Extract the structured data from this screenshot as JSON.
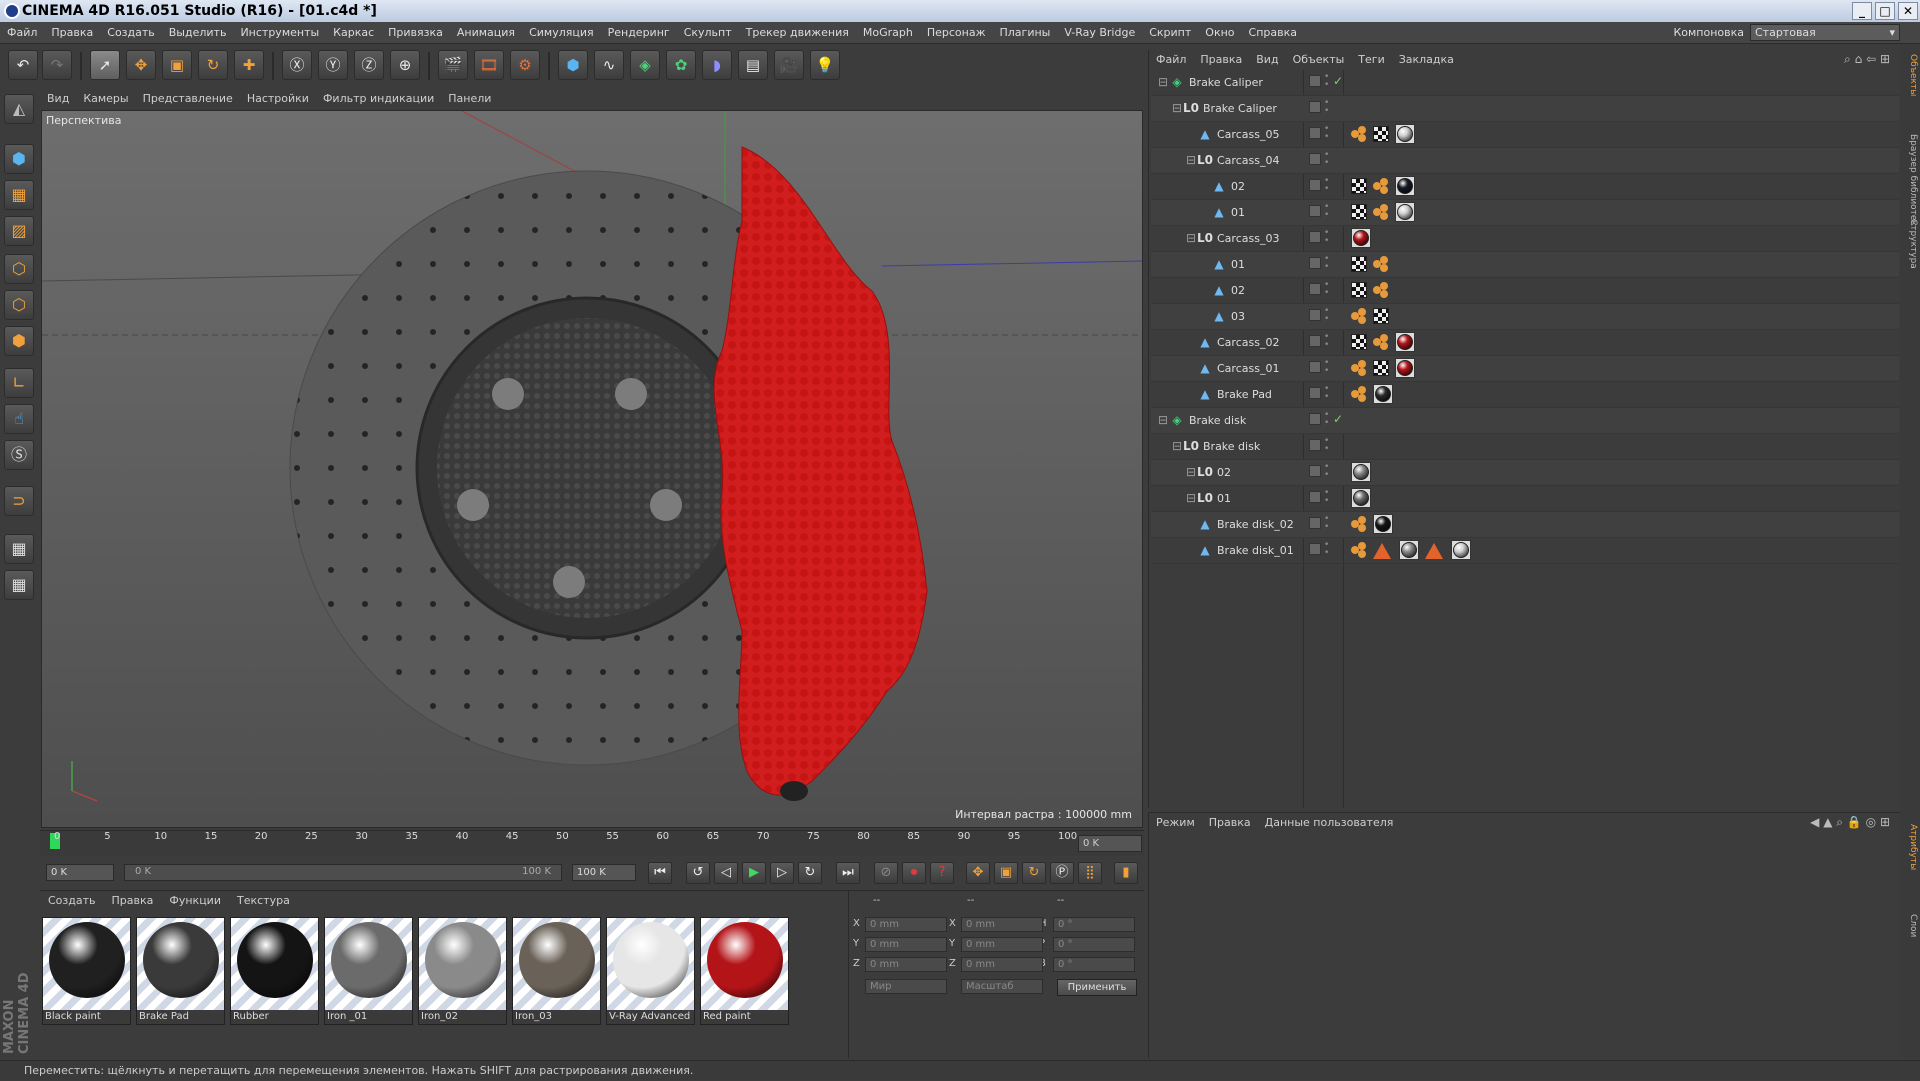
{
  "window": {
    "title": "CINEMA 4D R16.051 Studio (R16) - [01.c4d *]"
  },
  "menu": [
    "Файл",
    "Правка",
    "Создать",
    "Выделить",
    "Инструменты",
    "Каркас",
    "Привязка",
    "Анимация",
    "Симуляция",
    "Рендеринг",
    "Скульпт",
    "Трекер движения",
    "MoGraph",
    "Персонаж",
    "Плагины",
    "V-Ray Bridge",
    "Скрипт",
    "Окно",
    "Справка"
  ],
  "layout": {
    "label": "Компоновка",
    "value": "Стартовая"
  },
  "viewport": {
    "menu": [
      "Вид",
      "Камеры",
      "Представление",
      "Настройки",
      "Фильтр индикации",
      "Панели"
    ],
    "label": "Перспектива",
    "info": "Интервал растра : 100000 mm"
  },
  "timeline": {
    "ticks": [
      "0",
      "5",
      "10",
      "15",
      "20",
      "25",
      "30",
      "35",
      "40",
      "45",
      "50",
      "55",
      "60",
      "65",
      "70",
      "75",
      "80",
      "85",
      "90",
      "95",
      "100"
    ],
    "current": "0 K",
    "start": "0 K",
    "range_start": "0 K",
    "range_end": "100 K",
    "end": "100 K"
  },
  "materials": {
    "menu": [
      "Создать",
      "Правка",
      "Функции",
      "Текстура"
    ],
    "items": [
      {
        "name": "Black paint",
        "color": "#202020"
      },
      {
        "name": "Brake Pad",
        "color": "#3a3a3a"
      },
      {
        "name": "Rubber",
        "color": "#141414"
      },
      {
        "name": "Iron _01",
        "color": "#6b6b6b"
      },
      {
        "name": "Iron_02",
        "color": "#8a8a8a"
      },
      {
        "name": "Iron_03",
        "color": "#6a6258"
      },
      {
        "name": "V-Ray Advanced M",
        "color": "#e6e6e6"
      },
      {
        "name": "Red paint",
        "color": "#b31418"
      }
    ]
  },
  "coords": {
    "header": [
      "--",
      "--",
      "--"
    ],
    "rows": [
      {
        "a": "X",
        "v1": "0 mm",
        "b": "X",
        "v2": "0 mm",
        "c": "H",
        "v3": "0 °"
      },
      {
        "a": "Y",
        "v1": "0 mm",
        "b": "Y",
        "v2": "0 mm",
        "c": "P",
        "v3": "0 °"
      },
      {
        "a": "Z",
        "v1": "0 mm",
        "b": "Z",
        "v2": "0 mm",
        "c": "B",
        "v3": "0 °"
      }
    ],
    "mode1": "Мир",
    "mode2": "Масштаб",
    "apply": "Применить"
  },
  "objects": {
    "menu": [
      "Файл",
      "Правка",
      "Вид",
      "Объекты",
      "Теги",
      "Закладка"
    ],
    "rows": [
      {
        "name": "Brake Caliper",
        "icon": "group",
        "check": true,
        "tags": []
      },
      {
        "name": "Brake Caliper",
        "icon": "null",
        "check": false,
        "tags": []
      },
      {
        "name": "Carcass_05",
        "icon": "poly",
        "check": false,
        "tags": [
          "phong",
          "uv",
          "mat:#cfcfcf"
        ]
      },
      {
        "name": "Carcass_04",
        "icon": "null",
        "check": false,
        "tags": []
      },
      {
        "name": "02",
        "icon": "poly",
        "check": false,
        "tags": [
          "uv",
          "phong",
          "mat:#151b24"
        ]
      },
      {
        "name": "01",
        "icon": "poly",
        "check": false,
        "tags": [
          "uv",
          "phong",
          "mat:#cfcfcf"
        ]
      },
      {
        "name": "Carcass_03",
        "icon": "null",
        "check": false,
        "tags": [
          "mat:#b31418"
        ]
      },
      {
        "name": "01",
        "icon": "poly",
        "check": false,
        "tags": [
          "uv",
          "phong"
        ]
      },
      {
        "name": "02",
        "icon": "poly",
        "check": false,
        "tags": [
          "uv",
          "phong"
        ]
      },
      {
        "name": "03",
        "icon": "poly",
        "check": false,
        "tags": [
          "phong",
          "uv"
        ]
      },
      {
        "name": "Carcass_02",
        "icon": "poly",
        "check": false,
        "tags": [
          "uv",
          "phong",
          "mat:#b31418"
        ]
      },
      {
        "name": "Carcass_01",
        "icon": "poly",
        "check": false,
        "tags": [
          "phong",
          "uv",
          "mat:#b31418"
        ]
      },
      {
        "name": "Brake Pad",
        "icon": "poly",
        "check": false,
        "tags": [
          "phong",
          "mat:#2a2a2a"
        ]
      },
      {
        "name": "Brake disk",
        "icon": "group",
        "check": true,
        "tags": []
      },
      {
        "name": "Brake disk",
        "icon": "null",
        "check": false,
        "tags": []
      },
      {
        "name": "02",
        "icon": "null",
        "check": false,
        "tags": [
          "mat:#8a8a8a"
        ]
      },
      {
        "name": "01",
        "icon": "null",
        "check": false,
        "tags": [
          "mat:#6b6b6b"
        ]
      },
      {
        "name": "Brake disk_02",
        "icon": "poly",
        "check": false,
        "tags": [
          "phong",
          "mat:#141414"
        ]
      },
      {
        "name": "Brake disk_01",
        "icon": "poly",
        "check": false,
        "tags": [
          "phong",
          "tri",
          "mat:#8a8a8a",
          "tri",
          "mat:#cfcfcf"
        ]
      }
    ]
  },
  "attributes": {
    "menu": [
      "Режим",
      "Правка",
      "Данные пользователя"
    ]
  },
  "right_tabs": [
    "Объекты",
    "Браузер библиотек",
    "Структура",
    "Атрибуты",
    "Слои"
  ],
  "status": "Переместить: щёлкнуть и перетащить для перемещения элементов. Нажать SHIFT для растрирования движения.",
  "maxon": "MAXON CINEMA 4D"
}
